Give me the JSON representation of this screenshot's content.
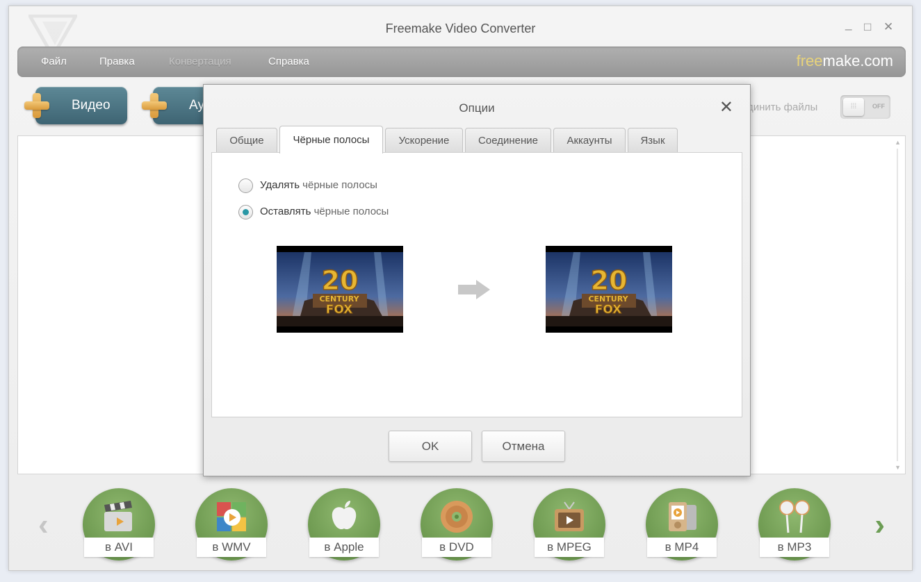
{
  "window": {
    "title": "Freemake Video Converter",
    "controls": {
      "minimize": "_",
      "maximize": "□",
      "close": "✕"
    }
  },
  "menu": {
    "items": [
      {
        "label": "Файл",
        "disabled": false
      },
      {
        "label": "Правка",
        "disabled": false
      },
      {
        "label": "Конвертация",
        "disabled": true
      },
      {
        "label": "Справка",
        "disabled": false
      }
    ],
    "brand_part1": "free",
    "brand_part2": "make.com"
  },
  "toolbar": {
    "add_video": "Видео",
    "add_audio": "Ауд",
    "join_files": "единить файлы",
    "toggle_state": "OFF",
    "toggle_knob": "⁞⁞⁞"
  },
  "converters": [
    {
      "label": "в AVI",
      "icon": "film-clapper-icon"
    },
    {
      "label": "в WMV",
      "icon": "windows-media-icon"
    },
    {
      "label": "в Apple",
      "icon": "apple-icon"
    },
    {
      "label": "в DVD",
      "icon": "dvd-disc-icon"
    },
    {
      "label": "в MPEG",
      "icon": "tv-icon"
    },
    {
      "label": "в MP4",
      "icon": "media-player-icon"
    },
    {
      "label": "в MP3",
      "icon": "headphones-icon"
    }
  ],
  "nav": {
    "prev": "‹",
    "next": "›"
  },
  "dialog": {
    "title": "Опции",
    "close": "✕",
    "tabs": [
      "Общие",
      "Чёрные полосы",
      "Ускорение",
      "Соединение",
      "Аккаунты",
      "Язык"
    ],
    "active_tab": 1,
    "options": [
      {
        "verb": "Удалять",
        "rest": " чёрные полосы",
        "checked": false
      },
      {
        "verb": "Оставлять",
        "rest": " чёрные полосы",
        "checked": true
      }
    ],
    "ok": "OK",
    "cancel": "Отмена"
  },
  "colors": {
    "accent_teal": "#2a97a5",
    "button_blue": "#4a7483",
    "converter_green": "#6c9d54",
    "brand_yellow": "#e8d37a"
  }
}
